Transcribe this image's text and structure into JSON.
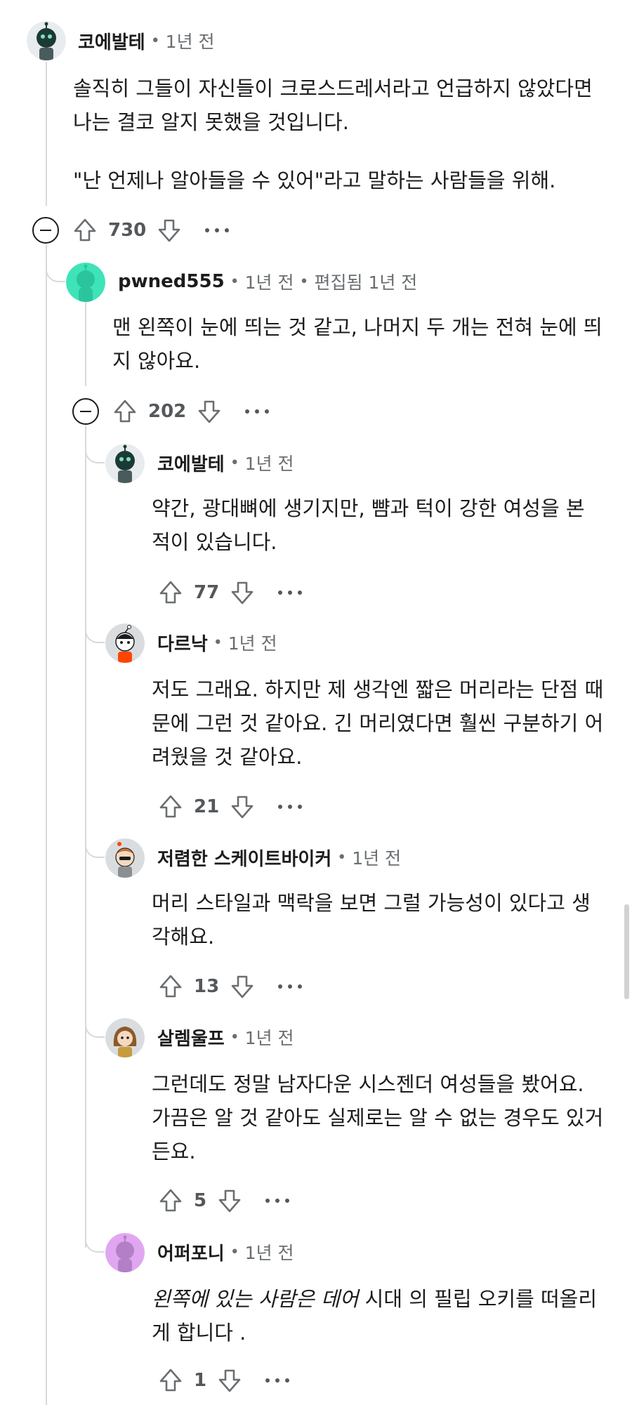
{
  "comments": [
    {
      "author": "코에발테",
      "time": "1년 전",
      "body": [
        "솔직히 그들이 자신들이 크로스드레서라고 언급하지 않았다면 나는 결코 알지 못했을 것입니다.",
        "\"난 언제나 알아들을 수 있어\"라고 말하는 사람들을 위해."
      ],
      "score": "730",
      "avatar_color": "#1b3a36"
    },
    {
      "author": "pwned555",
      "time": "1년 전",
      "edited": "편집됨 1년 전",
      "body": [
        "맨 왼쪽이 눈에 띄는 것 같고, 나머지 두 개는 전혀 눈에 띄지 않아요."
      ],
      "score": "202",
      "avatar_color": "#3ee4b8"
    },
    {
      "author": "코에발테",
      "time": "1년 전",
      "body": [
        "약간, 광대뼈에 생기지만, 뺨과 턱이 강한 여성을 본 적이 있습니다."
      ],
      "score": "77",
      "avatar_color": "#1b3a36"
    },
    {
      "author": "다르낙",
      "time": "1년 전",
      "body": [
        "저도 그래요. 하지만 제 생각엔 짧은 머리라는 단점 때문에 그런 것 같아요. 긴 머리였다면 훨씬 구분하기 어려웠을 것 같아요."
      ],
      "score": "21",
      "avatar_color": "#d9dde0"
    },
    {
      "author": "저렴한 스케이트바이커",
      "time": "1년 전",
      "body": [
        "머리 스타일과 맥락을 보면 그럴 가능성이 있다고 생각해요."
      ],
      "score": "13",
      "avatar_color": "#d9dde0"
    },
    {
      "author": "살렘울프",
      "time": "1년 전",
      "body": [
        "그런데도 정말 남자다운 시스젠더 여성들을 봤어요. 가끔은 알 것 같아도 실제로는 알 수 없는 경우도 있거든요."
      ],
      "score": "5",
      "avatar_color": "#d9dde0"
    },
    {
      "author": "어퍼포니",
      "time": "1년 전",
      "body_parts": {
        "italic": "왼쪽에 있는 사람은 데어",
        "normal": " 시대 의 필립 오키를 떠올리게 합니다 ."
      },
      "score": "1",
      "avatar_color": "#e0a7f0"
    }
  ],
  "icons": {
    "upvote": "upvote-arrow-icon",
    "downvote": "downvote-arrow-icon",
    "more": "more-options-icon",
    "collapse": "collapse-thread-icon"
  }
}
